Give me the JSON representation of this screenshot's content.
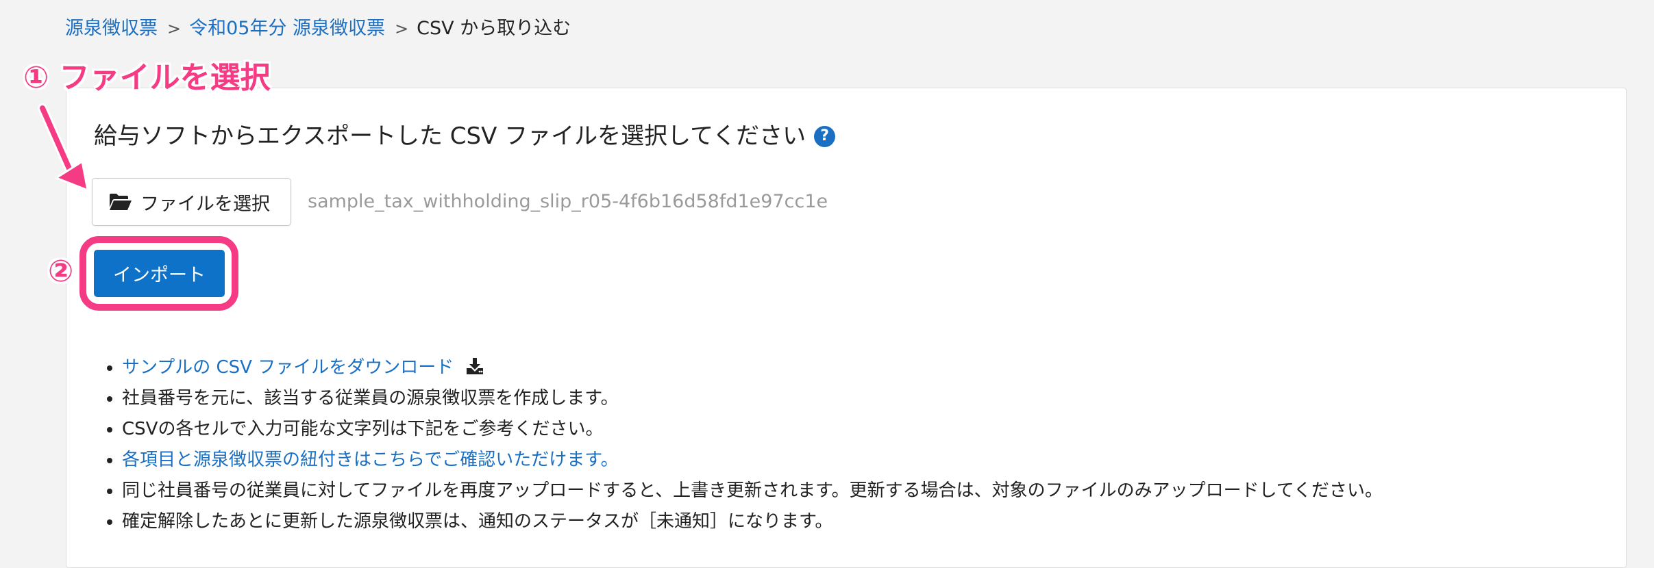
{
  "breadcrumb": {
    "items": [
      {
        "label": "源泉徴収票"
      },
      {
        "label": "令和05年分 源泉徴収票"
      }
    ],
    "current": "CSV から取り込む",
    "separator": ">"
  },
  "annotations": {
    "step1": "① ファイルを選択",
    "step2": "②"
  },
  "main": {
    "heading": "給与ソフトからエクスポートした CSV ファイルを選択してください",
    "help_icon": "?",
    "file_button_label": "ファイルを選択",
    "file_name": "sample_tax_withholding_slip_r05-4f6b16d58fd1e97cc1e",
    "import_button_label": "インポート"
  },
  "notes": {
    "download_link": "サンプルの CSV ファイルをダウンロード",
    "n1": "社員番号を元に、該当する従業員の源泉徴収票を作成します。",
    "n2": "CSVの各セルで入力可能な文字列は下記をご参考ください。",
    "link2": "各項目と源泉徴収票の紐付きはこちらでご確認いただけます。",
    "n3": "同じ社員番号の従業員に対してファイルを再度アップロードすると、上書き更新されます。更新する場合は、対象のファイルのみアップロードしてください。",
    "n4": "確定解除したあとに更新した源泉徴収票は、通知のステータスが［未通知］になります。"
  },
  "icons": {
    "help": "question-circle-icon",
    "folder": "folder-open-icon",
    "download": "download-icon"
  },
  "colors": {
    "link": "#1a6fc2",
    "primary": "#0f72c9",
    "annotation": "#f43b84",
    "background": "#f3f3f3"
  }
}
